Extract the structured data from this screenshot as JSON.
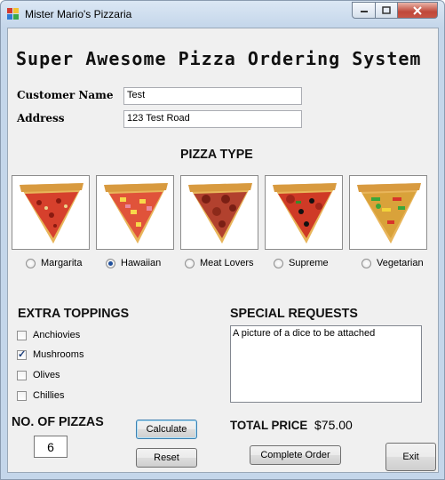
{
  "window": {
    "title": "Mister Mario's Pizzaria"
  },
  "heading": "Super Awesome Pizza Ordering System",
  "customer": {
    "name_label": "Customer Name",
    "name_value": "Test",
    "address_label": "Address",
    "address_value": "123 Test Road"
  },
  "pizza": {
    "section_title": "PIZZA TYPE",
    "types": [
      {
        "label": "Margarita",
        "selected": false
      },
      {
        "label": "Hawaiian",
        "selected": true
      },
      {
        "label": "Meat Lovers",
        "selected": false
      },
      {
        "label": "Supreme",
        "selected": false
      },
      {
        "label": "Vegetarian",
        "selected": false
      }
    ]
  },
  "toppings": {
    "section_title": "EXTRA TOPPINGS",
    "items": [
      {
        "label": "Anchiovies",
        "checked": false
      },
      {
        "label": "Mushrooms",
        "checked": true
      },
      {
        "label": "Olives",
        "checked": false
      },
      {
        "label": "Chillies",
        "checked": false
      }
    ]
  },
  "special": {
    "section_title": "SPECIAL REQUESTS",
    "value": "A picture of a dice to be attached"
  },
  "quantity": {
    "label": "NO. OF PIZZAS",
    "value": "6"
  },
  "total": {
    "label": "TOTAL PRICE",
    "value": "$75.00"
  },
  "buttons": {
    "calculate": "Calculate",
    "reset": "Reset",
    "complete": "Complete Order",
    "exit": "Exit"
  },
  "colors": {
    "window_frame": "#c4d6ea",
    "client_bg": "#f0f0f0",
    "close_button": "#c75444"
  }
}
